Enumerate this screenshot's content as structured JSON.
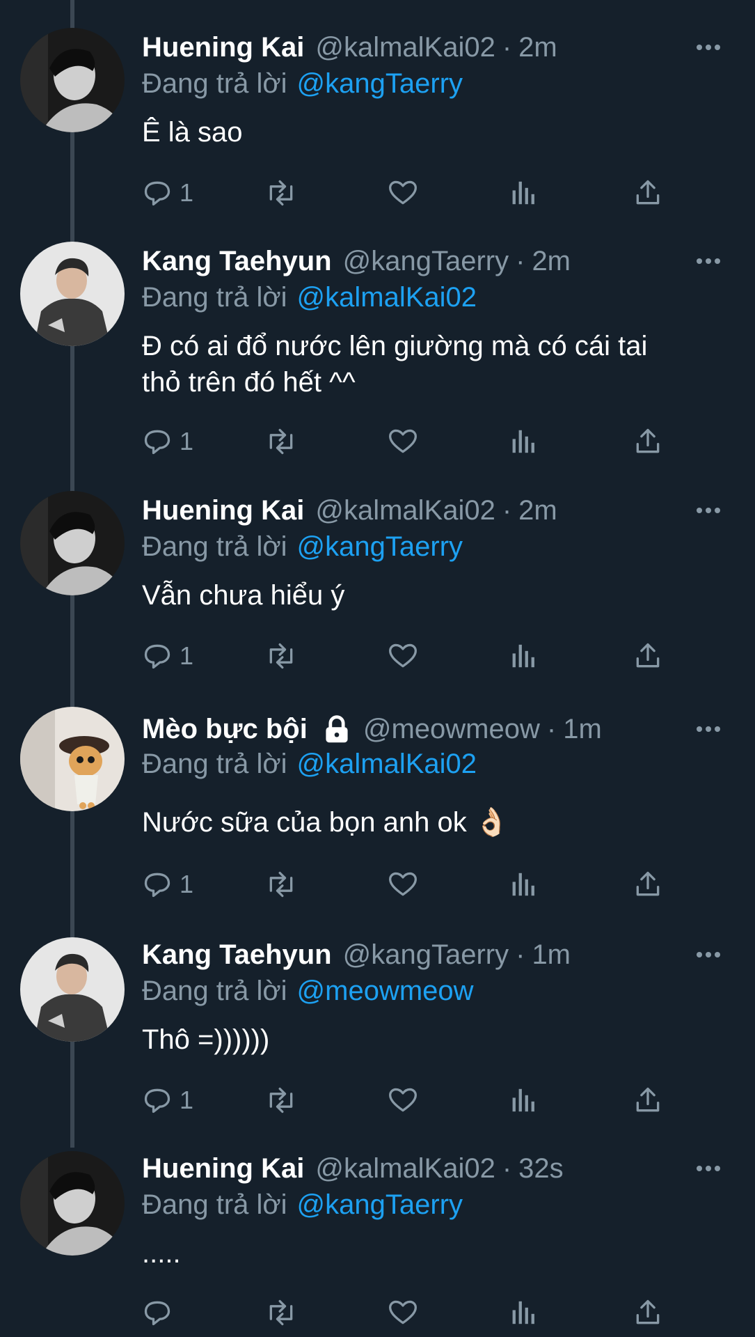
{
  "replying_label": "Đang trả lời",
  "colors": {
    "background": "#15202b",
    "secondary_text": "#8899a6",
    "link": "#1da1f2"
  },
  "tweets": [
    {
      "name": "Huening Kai",
      "handle": "@kalmalKai02",
      "time": "2m",
      "replying_to": "@kangTaerry",
      "text_lines": [
        "Ê là sao"
      ],
      "reply_count": "1",
      "avatar": "avatar-huening-kai",
      "locked": false
    },
    {
      "name": "Kang Taehyun",
      "handle": "@kangTaerry",
      "time": "2m",
      "replying_to": "@kalmalKai02",
      "text_lines": [
        "Đ có ai đổ nước lên giường mà có cái tai",
        "thỏ trên đó hết ^^"
      ],
      "reply_count": "1",
      "avatar": "avatar-kang-taehyun",
      "locked": false
    },
    {
      "name": "Huening Kai",
      "handle": "@kalmalKai02",
      "time": "2m",
      "replying_to": "@kangTaerry",
      "text_lines": [
        "Vẫn chưa hiểu ý"
      ],
      "reply_count": "1",
      "avatar": "avatar-huening-kai",
      "locked": false
    },
    {
      "name": "Mèo bực bội",
      "handle": "@meowmeow",
      "time": "1m",
      "replying_to": "@kalmalKai02",
      "text_lines": [
        "Nước sữa của bọn anh ok 👌🏻"
      ],
      "reply_count": "1",
      "avatar": "avatar-cat",
      "locked": true
    },
    {
      "name": "Kang Taehyun",
      "handle": "@kangTaerry",
      "time": "1m",
      "replying_to": "@meowmeow",
      "text_lines": [
        "Thô =))))))"
      ],
      "reply_count": "1",
      "avatar": "avatar-kang-taehyun",
      "locked": false
    },
    {
      "name": "Huening Kai",
      "handle": "@kalmalKai02",
      "time": "32s",
      "replying_to": "@kangTaerry",
      "text_lines": [
        "....."
      ],
      "reply_count": "",
      "avatar": "avatar-huening-kai",
      "locked": false
    }
  ]
}
